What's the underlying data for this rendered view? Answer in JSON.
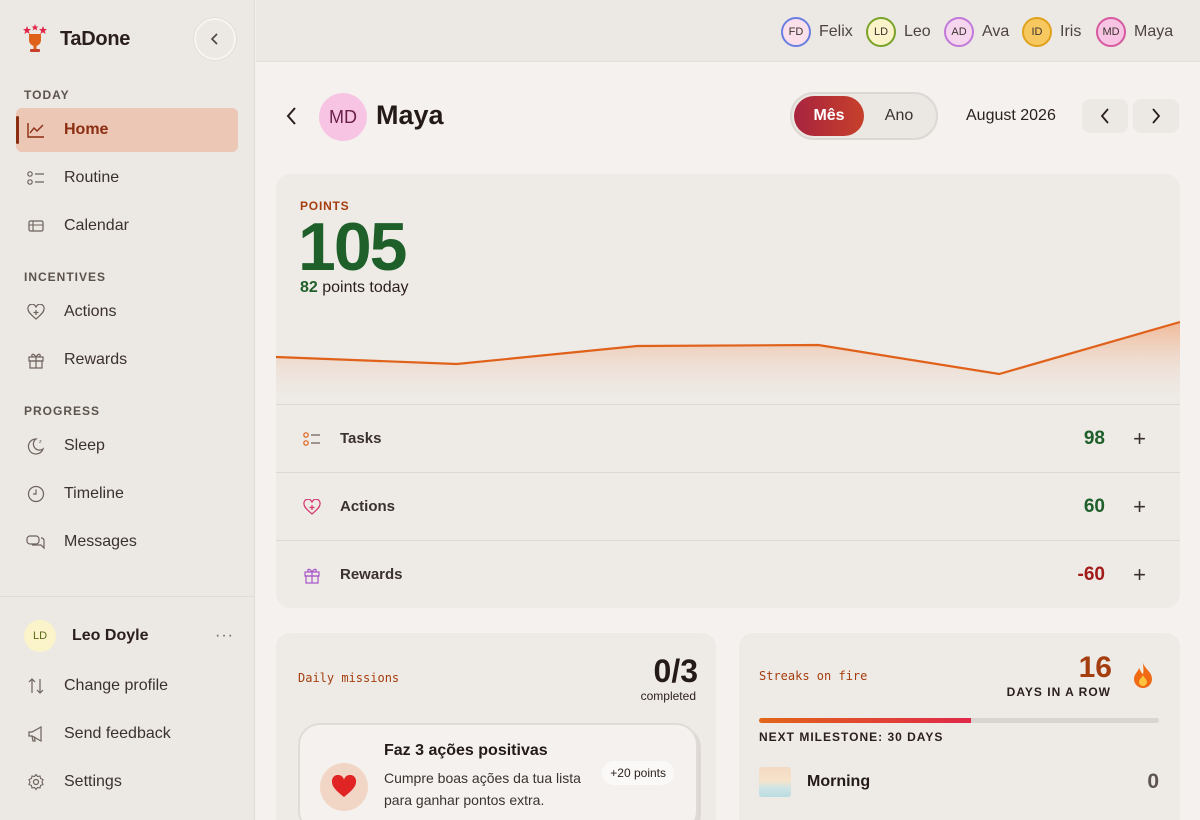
{
  "app": {
    "name": "TaDone"
  },
  "sidebar": {
    "sections": [
      {
        "label": "TODAY",
        "items": [
          {
            "label": "Home",
            "icon": "chart-line-icon",
            "active": true
          },
          {
            "label": "Routine",
            "icon": "list-check-icon"
          },
          {
            "label": "Calendar",
            "icon": "calendar-icon"
          }
        ]
      },
      {
        "label": "INCENTIVES",
        "items": [
          {
            "label": "Actions",
            "icon": "heart-plus-icon"
          },
          {
            "label": "Rewards",
            "icon": "gift-icon"
          }
        ]
      },
      {
        "label": "PROGRESS",
        "items": [
          {
            "label": "Sleep",
            "icon": "moon-icon"
          },
          {
            "label": "Timeline",
            "icon": "clock-icon"
          },
          {
            "label": "Messages",
            "icon": "chat-icon"
          }
        ]
      }
    ],
    "profile": {
      "initials": "LD",
      "name": "Leo Doyle",
      "more": "···"
    },
    "footer": [
      {
        "label": "Change profile",
        "icon": "swap-icon"
      },
      {
        "label": "Send feedback",
        "icon": "megaphone-icon"
      },
      {
        "label": "Settings",
        "icon": "gear-icon"
      }
    ]
  },
  "topbar": {
    "members": [
      {
        "initials": "FD",
        "name": "Felix",
        "color": "#6b7fe0",
        "bg": "#fbe0ec"
      },
      {
        "initials": "LD",
        "name": "Leo",
        "color": "#7aa32a",
        "bg": "#fbf3c9"
      },
      {
        "initials": "AD",
        "name": "Ava",
        "color": "#c17ad9",
        "bg": "#f6d6ef"
      },
      {
        "initials": "ID",
        "name": "Iris",
        "color": "#e0a21c",
        "bg": "#f7c860"
      },
      {
        "initials": "MD",
        "name": "Maya",
        "color": "#d65aa0",
        "bg": "#f8c4e3"
      }
    ]
  },
  "header": {
    "initials": "MD",
    "name": "Maya",
    "period_options": [
      "Mês",
      "Ano"
    ],
    "period_selected": "Mês",
    "month": "August 2026"
  },
  "points": {
    "label": "POINTS",
    "total": "105",
    "today_value": "82",
    "today_suffix": " points today",
    "chart_data": {
      "type": "area",
      "values": [
        27,
        20,
        38,
        39,
        10,
        62
      ]
    },
    "rows": [
      {
        "label": "Tasks",
        "value": "98",
        "color": "#1e5f2a",
        "icon": "list-check-icon"
      },
      {
        "label": "Actions",
        "value": "60",
        "color": "#1e5f2a",
        "icon": "heart-plus-icon"
      },
      {
        "label": "Rewards",
        "value": "-60",
        "color": "#a11b1b",
        "icon": "gift-icon"
      }
    ],
    "add_symbol": "+"
  },
  "missions": {
    "label": "Daily missions",
    "count": "0/3",
    "count_sub": "completed",
    "item": {
      "title": "Faz 3 ações positivas",
      "desc": "Cumpre boas ações da tua lista para ganhar pontos extra.",
      "badge": "+20 points",
      "icon": "heart-icon"
    }
  },
  "streaks": {
    "label": "Streaks on fire",
    "days": "16",
    "days_label": "DAYS IN A ROW",
    "progress": 0.53,
    "milestone": "NEXT MILESTONE: 30 DAYS",
    "row": {
      "label": "Morning",
      "value": "0"
    }
  },
  "colors": {
    "accent": "#a53e0e",
    "positive": "#1e5f2a",
    "negative": "#a11b1b",
    "line": "#e0611a"
  }
}
